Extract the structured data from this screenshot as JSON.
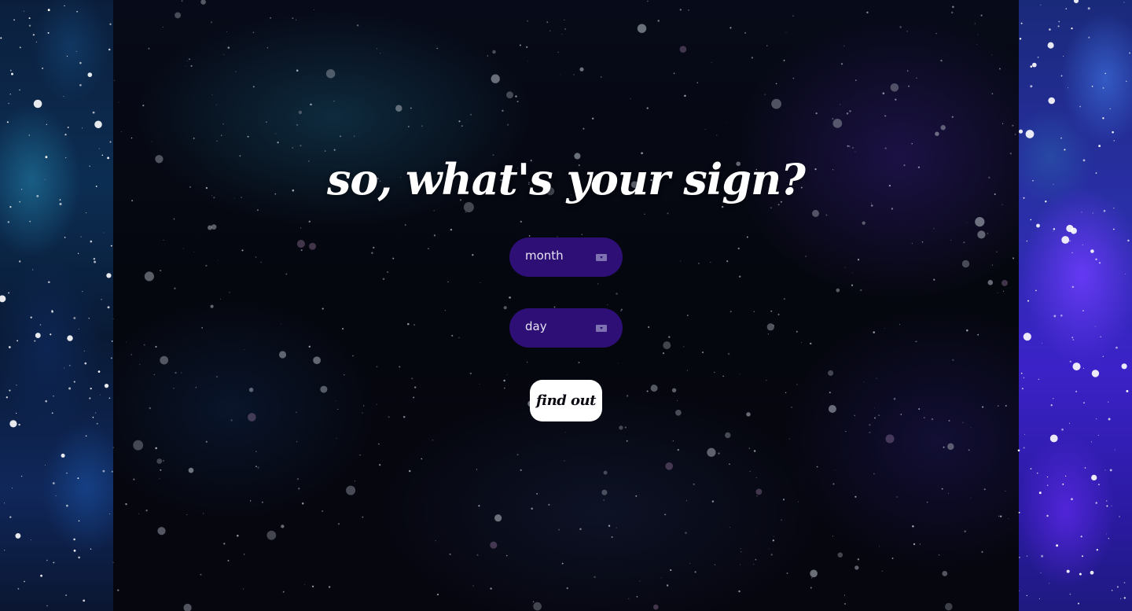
{
  "page": {
    "heading": "so, what's your sign?"
  },
  "form": {
    "month_select": {
      "selected": "month",
      "icon": "chevron-down-icon"
    },
    "day_select": {
      "selected": "day",
      "icon": "chevron-down-icon"
    },
    "submit_label": "find out"
  },
  "colors": {
    "select_background": "#2d0f75",
    "button_background": "#ffffff",
    "heading_color": "#ffffff"
  }
}
